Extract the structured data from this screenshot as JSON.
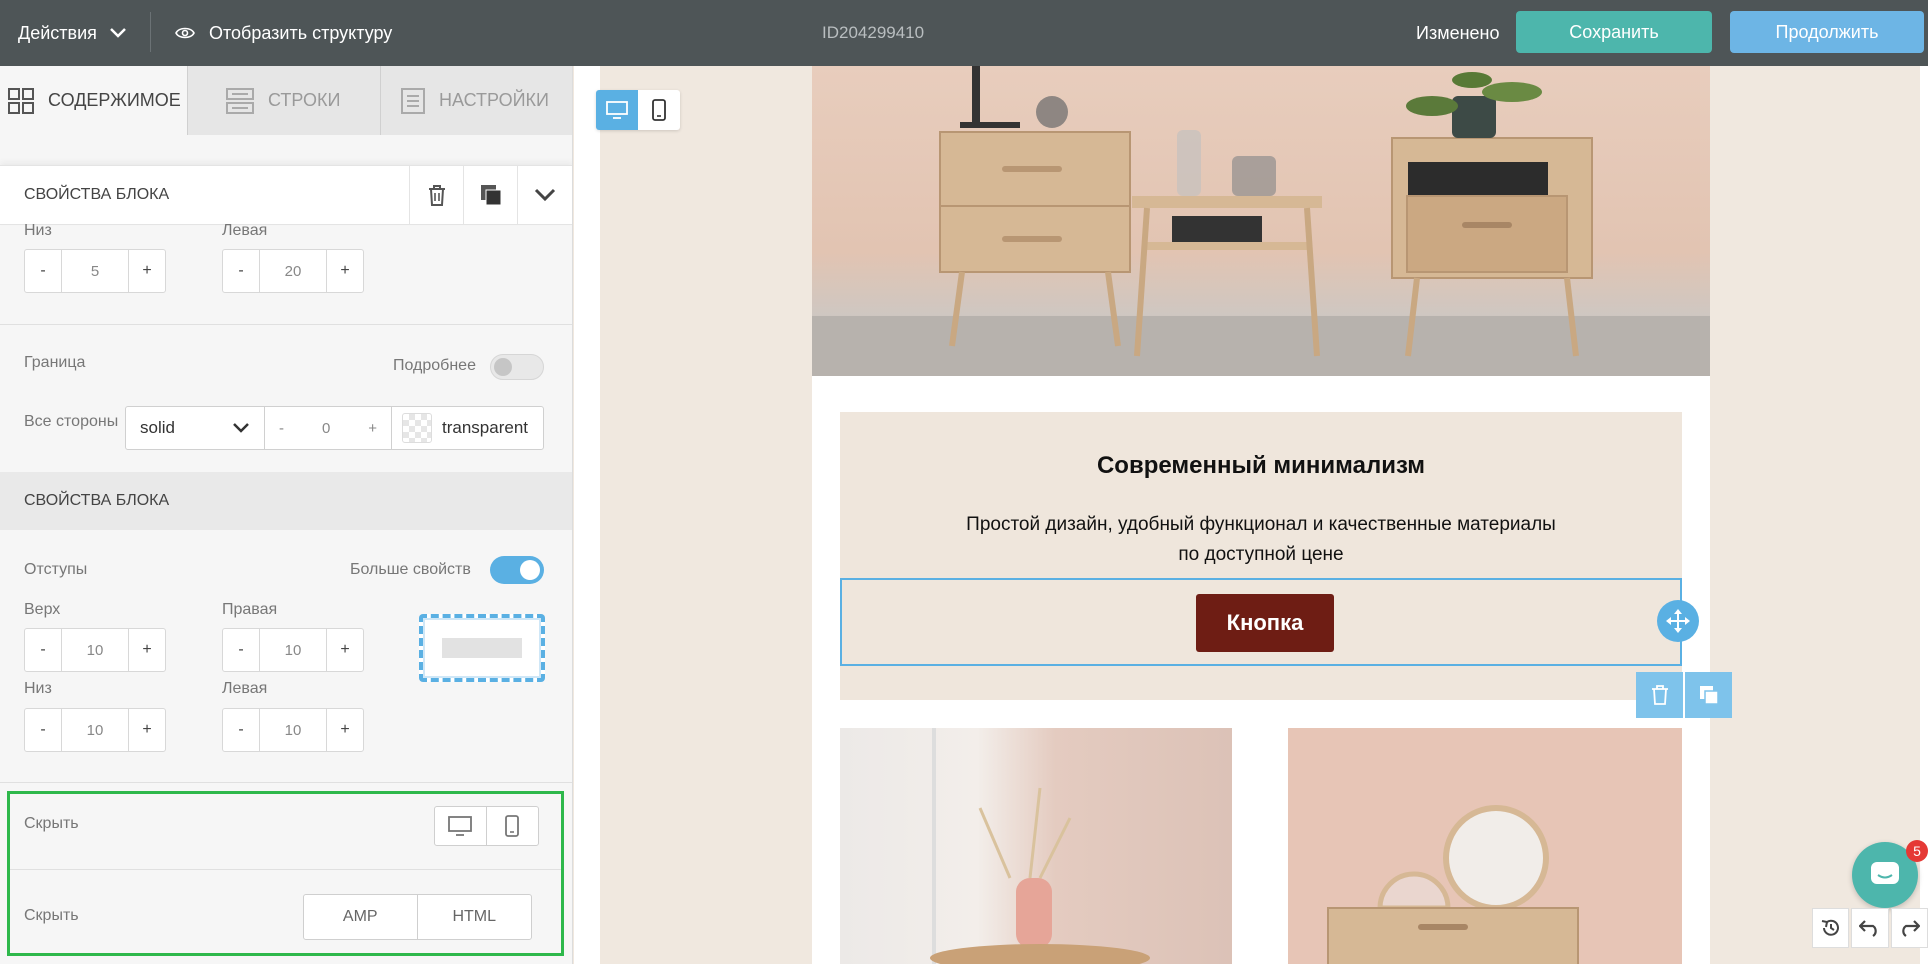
{
  "topbar": {
    "actions_label": "Действия",
    "structure_label": "Отобразить структуру",
    "doc_id": "ID204299410",
    "status": "Изменено",
    "save_label": "Сохранить",
    "continue_label": "Продолжить"
  },
  "tabs": [
    {
      "label": "СОДЕРЖИМОЕ",
      "icon": "grid-icon",
      "active": true
    },
    {
      "label": "СТРОКИ",
      "icon": "rows-icon",
      "active": false
    },
    {
      "label": "НАСТРОЙКИ",
      "icon": "settings-doc-icon",
      "active": false
    }
  ],
  "block_header": {
    "title": "СВОЙСТВА БЛОКА"
  },
  "padding_top_group": {
    "bottom_label": "Низ",
    "bottom_value": "5",
    "left_label": "Левая",
    "left_value": "20"
  },
  "border": {
    "label": "Граница",
    "more_label": "Подробнее",
    "all_sides_label": "Все стороны",
    "style_value": "solid",
    "width_value": "0",
    "color_value": "transparent"
  },
  "section2": {
    "title": "СВОЙСТВА БЛОКА",
    "padding_label": "Отступы",
    "more_props_label": "Больше свойств",
    "top_label": "Верх",
    "top_value": "10",
    "right_label": "Правая",
    "right_value": "10",
    "bottom_label": "Низ",
    "bottom_value": "10",
    "left_label": "Левая",
    "left_value": "10"
  },
  "hide": {
    "label1": "Скрыть",
    "label2": "Скрыть",
    "amp_label": "AMP",
    "html_label": "HTML"
  },
  "stepper": {
    "minus": "-",
    "plus": "+"
  },
  "email": {
    "title": "Современный минимализм",
    "text_line1": "Простой дизайн, удобный функционал и качественные материалы",
    "text_line2": "по доступной цене",
    "button_label": "Кнопка"
  },
  "chat": {
    "badge": "5"
  },
  "colors": {
    "topbar": "#4e5557",
    "save": "#4db6ac",
    "continue": "#6db5e5",
    "accent": "#5ab0e3",
    "cta": "#6e1d14",
    "highlight": "#2eb84b"
  }
}
